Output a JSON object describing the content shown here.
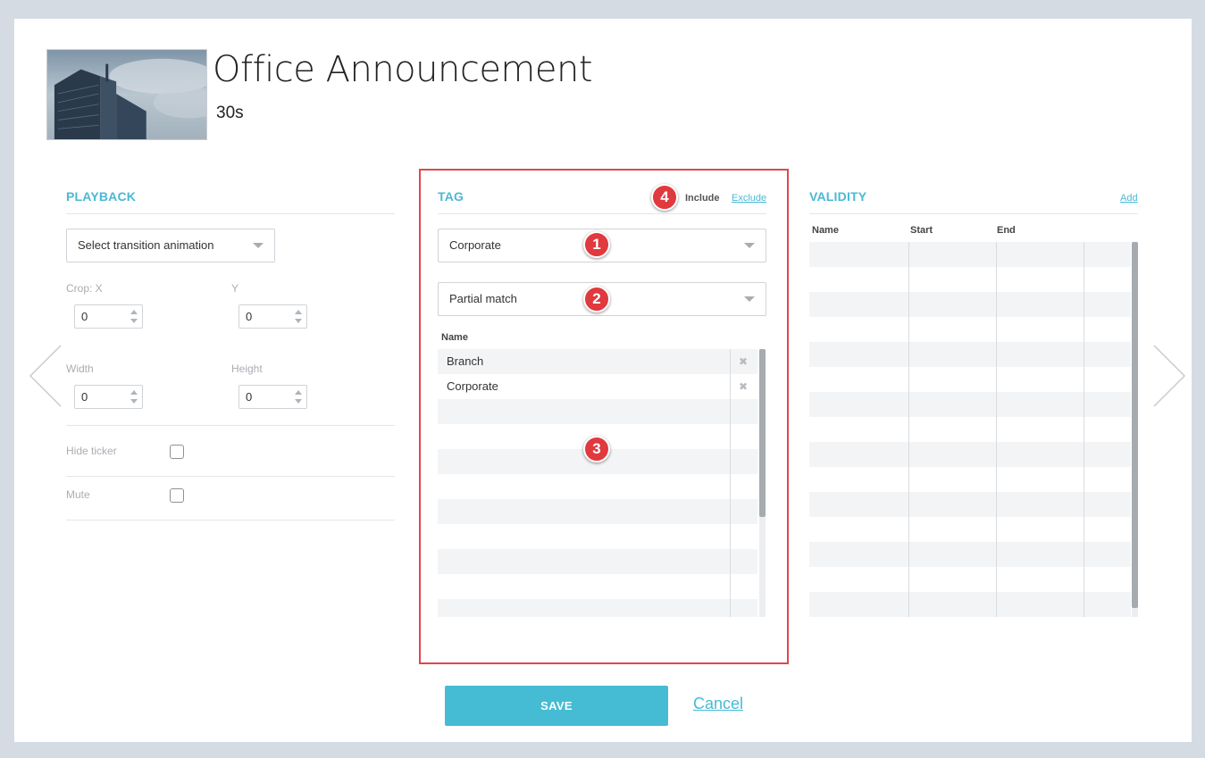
{
  "header": {
    "title": "Office Announcement",
    "duration": "30s"
  },
  "playback": {
    "section_title": "PLAYBACK",
    "transition_select": "Select transition animation",
    "crop_x_label": "Crop: X",
    "crop_y_label": "Y",
    "crop_x_value": "0",
    "crop_y_value": "0",
    "width_label": "Width",
    "height_label": "Height",
    "width_value": "0",
    "height_value": "0",
    "hide_ticker_label": "Hide ticker",
    "mute_label": "Mute",
    "hide_ticker_checked": false,
    "mute_checked": false
  },
  "tag": {
    "section_title": "TAG",
    "include_label": "Include",
    "exclude_label": "Exclude",
    "tag_select": "Corporate",
    "match_select": "Partial match",
    "name_header": "Name",
    "rows": [
      {
        "name": "Branch",
        "remove": "✖"
      },
      {
        "name": "Corporate",
        "remove": "✖"
      }
    ],
    "badges": [
      "1",
      "2",
      "3",
      "4"
    ]
  },
  "validity": {
    "section_title": "VALIDITY",
    "add_label": "Add",
    "columns": [
      "Name",
      "Start",
      "End"
    ]
  },
  "footer": {
    "save_label": "SAVE",
    "cancel_label": "Cancel"
  },
  "colors": {
    "accent": "#45bcd3",
    "highlight_border": "#e0474c",
    "badge": "#e0393e"
  }
}
